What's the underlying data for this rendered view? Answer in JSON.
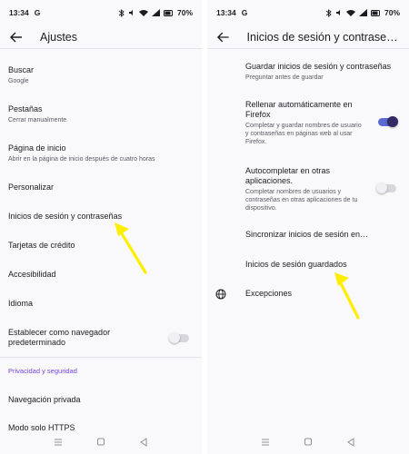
{
  "left": {
    "status": {
      "time": "13:34",
      "carrier": "G",
      "battery": "70%"
    },
    "title": "Ajustes",
    "items": [
      {
        "title": "Buscar",
        "subtitle": "Google"
      },
      {
        "title": "Pestañas",
        "subtitle": "Cerrar manualmente"
      },
      {
        "title": "Página de inicio",
        "subtitle": "Abrir en la página de inicio después de cuatro horas"
      },
      {
        "title": "Personalizar"
      },
      {
        "title": "Inicios de sesión y contraseñas"
      },
      {
        "title": "Tarjetas de crédito"
      },
      {
        "title": "Accesibilidad"
      },
      {
        "title": "Idioma"
      },
      {
        "title": "Establecer como navegador predeterminado",
        "toggle": false
      },
      {
        "title": "Navegación privada"
      },
      {
        "title": "Modo solo HTTPS"
      }
    ],
    "section": "Privacidad y seguridad"
  },
  "right": {
    "status": {
      "time": "13:34",
      "carrier": "G",
      "battery": "70%"
    },
    "title": "Inicios de sesión y contraseñas",
    "items": [
      {
        "title": "Guardar inicios de sesión y contraseñas",
        "subtitle": "Preguntar antes de guardar"
      },
      {
        "title": "Rellenar automáticamente en Firefox",
        "subtitle": "Completar y guardar nombres de usuario y contraseñas en páginas web al usar Firefox.",
        "toggle": true
      },
      {
        "title": "Autocompletar en otras aplicaciones.",
        "subtitle": "Completar nombres de usuarios y contraseñas en otras aplicaciones de tu dispositivo.",
        "toggle": false
      },
      {
        "title": "Sincronizar inicios de sesión en…"
      },
      {
        "title": "Inicios de sesión guardados"
      },
      {
        "title": "Excepciones",
        "icon": "globe-icon"
      }
    ]
  },
  "colors": {
    "accent": "#7542e5",
    "arrow": "#ffee00",
    "toggle_on": "#312a65"
  }
}
